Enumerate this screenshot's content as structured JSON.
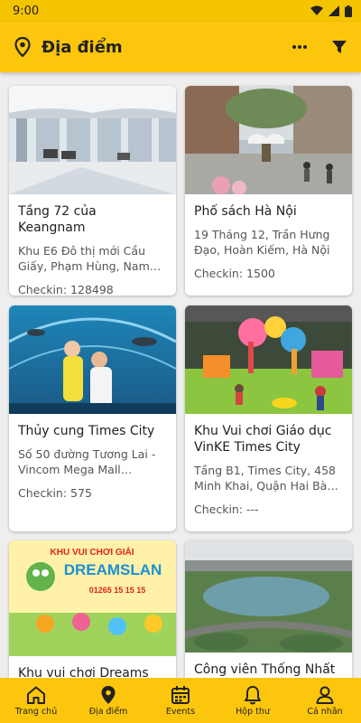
{
  "status": {
    "time": "9:00"
  },
  "app_bar": {
    "title": "Địa điểm"
  },
  "places": [
    {
      "title": "Tầng 72 của Keangnam",
      "address": "Khu E6 Đô thị mới Cầu Giấy, Phạm Hùng, Nam T...",
      "checkin": "Checkin: 128498"
    },
    {
      "title": "Phố sách Hà Nội",
      "address": "19 Tháng 12, Trần Hưng Đạo, Hoàn Kiếm, Hà Nội",
      "checkin": "Checkin: 1500"
    },
    {
      "title": "Thủy cung Times City",
      "address": "Số 50 đường Tương Lai - Vincom Mega Mall Times...",
      "checkin": "Checkin: 575"
    },
    {
      "title": "Khu Vui chơi Giáo dục VinKE Times City",
      "address": "Tầng B1, Times City, 458 Minh Khai, Quận Hai Bà T...",
      "checkin": "Checkin: ---"
    },
    {
      "title": "Khu vui chơi Dreams",
      "address": "",
      "checkin": ""
    },
    {
      "title": "Công viên Thống Nhất",
      "address": "",
      "checkin": ""
    }
  ],
  "image_text": {
    "dreams_line1": "KHU VUI CHƠI GIẢI",
    "dreams_line2": "DREAMSLAN",
    "dreams_phone": "01265 15 15 15"
  },
  "nav": [
    {
      "label": "Trang chủ",
      "icon": "home-icon"
    },
    {
      "label": "Địa điểm",
      "icon": "location-pin-icon"
    },
    {
      "label": "Events",
      "icon": "calendar-icon"
    },
    {
      "label": "Hộp thư",
      "icon": "bell-icon"
    },
    {
      "label": "Cá nhân",
      "icon": "person-icon"
    }
  ],
  "colors": {
    "accent": "#fcc60d",
    "status_bar": "#f5c400",
    "background": "#eeeeee"
  }
}
